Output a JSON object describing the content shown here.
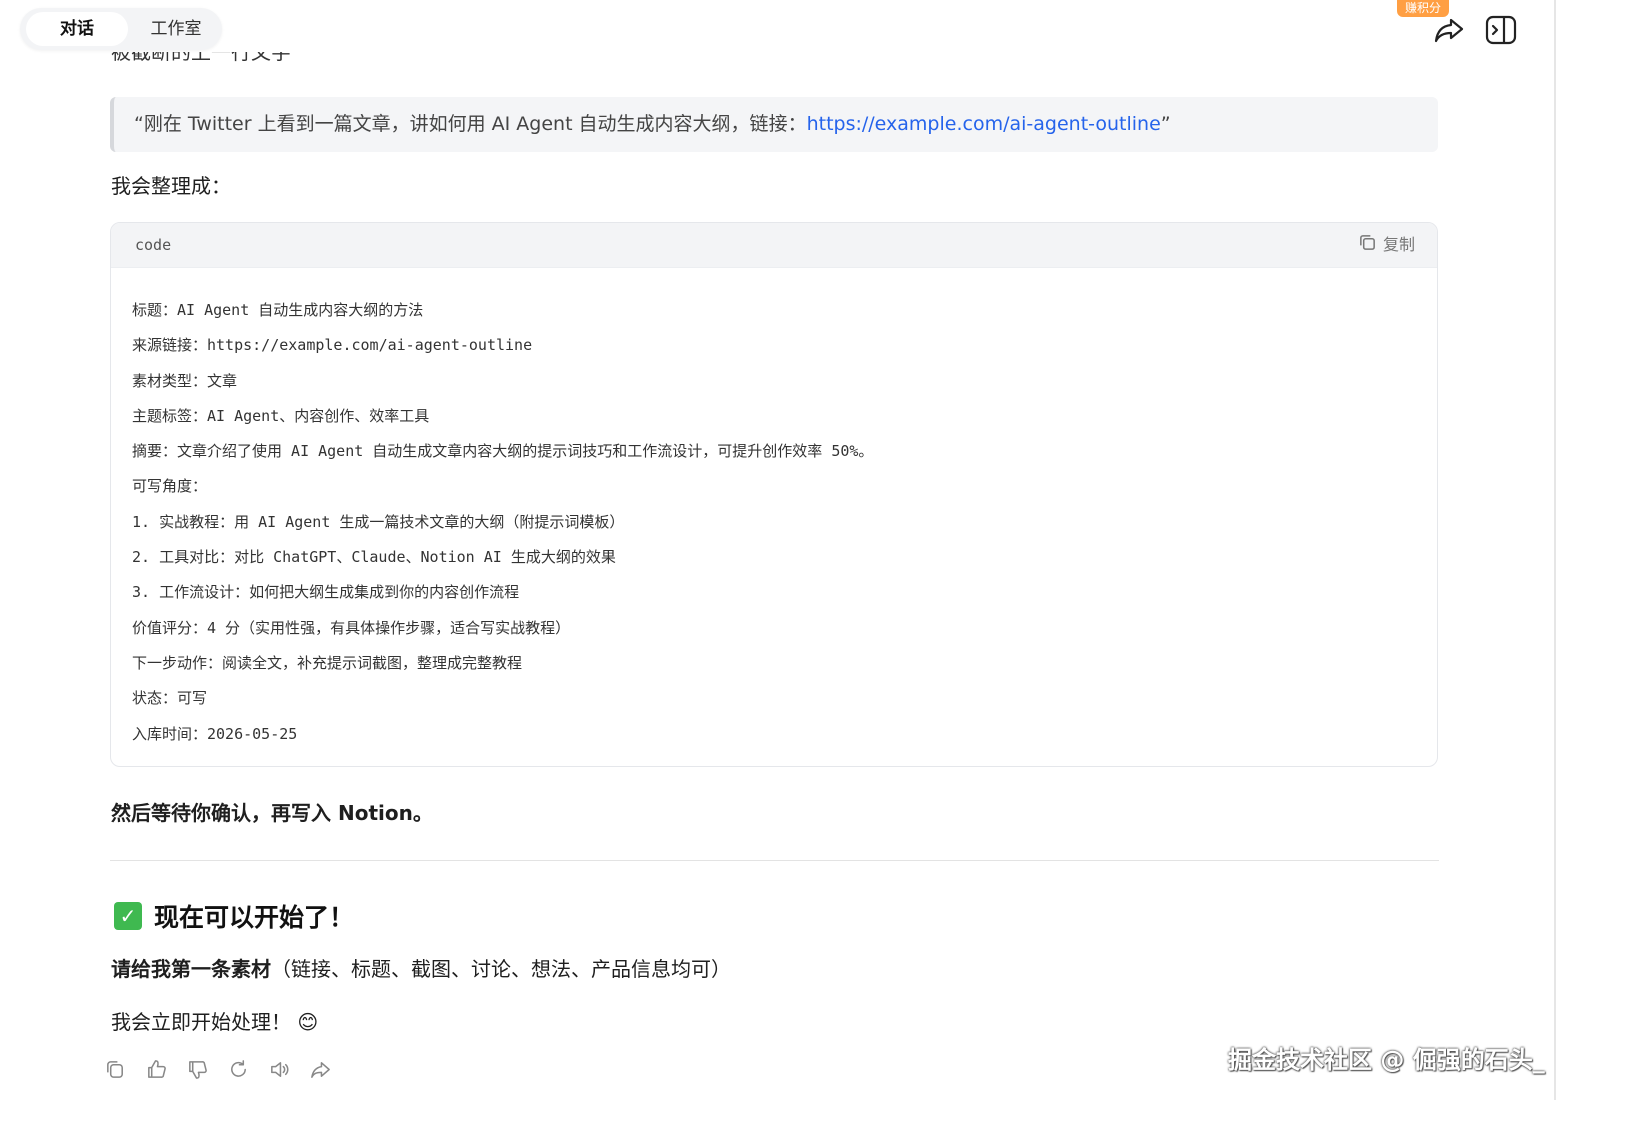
{
  "tabs": {
    "chat": "对话",
    "studio": "工作室"
  },
  "top_bar": {
    "badge": "赚积分",
    "share_icon": "share-icon",
    "panel_icon": "sidebar-panel-icon"
  },
  "cut_text": "被截断的上一行文字",
  "quote": {
    "prefix": "“刚在 Twitter 上看到一篇文章，讲如何用 AI Agent 自动生成内容大纲，链接：",
    "link": "https://example.com/ai-agent-outline",
    "suffix": "”"
  },
  "intro": "我会整理成：",
  "code": {
    "lang": "code",
    "copy_label": "复制",
    "lines": [
      "标题：AI Agent 自动生成内容大纲的方法",
      "来源链接：https://example.com/ai-agent-outline",
      "素材类型：文章",
      "主题标签：AI Agent、内容创作、效率工具",
      "摘要：文章介绍了使用 AI Agent 自动生成文章内容大纲的提示词技巧和工作流设计，可提升创作效率 50%。",
      "可写角度：",
      "1. 实战教程：用 AI Agent 生成一篇技术文章的大纲（附提示词模板）",
      "2. 工具对比：对比 ChatGPT、Claude、Notion AI 生成大纲的效果",
      "3. 工作流设计：如何把大纲生成集成到你的内容创作流程",
      "价值评分：4 分（实用性强，有具体操作步骤，适合写实战教程）",
      "下一步动作：阅读全文，补充提示词截图，整理成完整教程",
      "状态：可写",
      "入库时间：2026-05-25"
    ]
  },
  "confirm_text": "然后等待你确认，再写入 Notion。",
  "heading": "现在可以开始了！",
  "request": {
    "bold": "请给我第一条素材",
    "rest": "（链接、标题、截图、讨论、想法、产品信息均可）"
  },
  "closing": "我会立即开始处理！",
  "closing_emoji": "😊",
  "watermark": "掘金技术社区 @ 倔强的石头_",
  "colors": {
    "link": "#2563eb",
    "badge": "#ff9f43",
    "check": "#3fb950"
  }
}
